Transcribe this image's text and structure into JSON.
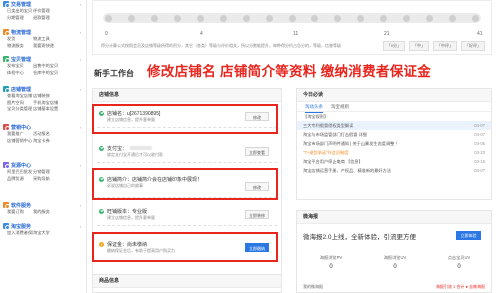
{
  "sidebar": {
    "groups": [
      {
        "title": "交易管理",
        "icon": "trade-icon",
        "color": "#3a8ee6",
        "rows": [
          [
            "已卖出的宝贝",
            "评价管理"
          ],
          [
            "分期管理",
            "退款管理"
          ]
        ]
      },
      {
        "title": "物流管理",
        "icon": "truck-icon",
        "color": "#f08a24",
        "rows": [
          [
            "发货",
            "物流工具"
          ],
          [
            "物流服务",
            "我要寄快递"
          ]
        ]
      },
      {
        "title": "宝贝管理",
        "icon": "goods-icon",
        "color": "#3cb371",
        "rows": [
          [
            "发布宝贝",
            "出售中的宝贝"
          ],
          [
            "体检中心",
            "仓库中的宝贝"
          ]
        ]
      },
      {
        "title": "店铺管理",
        "icon": "shop-icon",
        "color": "#21a0b5",
        "rows": [
          [
            "查看淘宝店铺",
            "店铺装修"
          ],
          [
            "图片空间",
            "手机淘宝店铺"
          ],
          [
            "宝贝分类管理",
            "店铺基本设置"
          ]
        ]
      },
      {
        "title": "营销中心",
        "icon": "marketing-icon",
        "color": "#e04b4b",
        "rows": [
          [
            "我要推广",
            "活动报名"
          ],
          [
            "店铺营销中心",
            "淘宝卡券"
          ]
        ]
      },
      {
        "title": "货源中心",
        "icon": "supply-icon",
        "color": "#7b68ee",
        "rows": [
          [
            "阿里巴巴批发",
            "分销管理"
          ],
          [
            "品牌货源",
            "采购导航"
          ]
        ]
      },
      {
        "title": "软件服务",
        "icon": "software-icon",
        "color": "#f08a24",
        "rows": [
          [
            "我要订购",
            "我的服务"
          ]
        ]
      },
      {
        "title": "淘宝服务",
        "icon": "service-icon",
        "color": "#3a8ee6",
        "rows": [
          [
            "加入消费者保障",
            "淘宝大学"
          ]
        ]
      }
    ]
  },
  "top_chart": {
    "scale_labels": [
      "0",
      "4",
      "11",
      "21",
      "41"
    ],
    "note": "得分计算公式按照会员及店铺等级所得的积分，其它（各类）等级与评价相关，所以分数能提升，每种得分约占总分的，等级，信誉等级",
    "buttons": [
      "「0分」",
      "「中」",
      "「中评」",
      "「好评」"
    ]
  },
  "headline": "修改店铺名 店铺简介等资料  缴纳消费者保证金",
  "section_title": "新手工作台",
  "store_card": {
    "title": "店铺信息",
    "tasks": [
      {
        "main": "店铺名：u[2671390895]",
        "sub": "建立店铺信息，提升客单量",
        "btn": "修改",
        "status": "done"
      },
      {
        "main": "支付宝：",
        "sub": "绑定支付宝开通后才可以收付款",
        "btn": "立即查看",
        "status": "done"
      },
      {
        "main": "店铺简介：店铺简介会在店铺印象中展现！",
        "sub": "诉说店铺自己的故事",
        "btn": "修改",
        "status": "done"
      },
      {
        "main": "旺铺版本：专业版",
        "sub": "建立店铺信息，提升客单量",
        "btn": "立即装修",
        "status": "done"
      },
      {
        "main": "保证金：尚未缴纳",
        "sub": "缴纳保证金后，有助于提高用户购买力",
        "btn": "立即缴纳",
        "status": "warn"
      }
    ]
  },
  "goods_card": {
    "title": "商品信息"
  },
  "today": {
    "title": "今日必读",
    "tabs": [
      "淘动头条",
      "淘宝规则"
    ],
    "news": [
      {
        "text": "【淘宝规则】",
        "date": "",
        "style": "plain"
      },
      {
        "text": "三大专利假冒侵权类型解读",
        "date": "04-07",
        "style": "highlight"
      },
      {
        "text": "淘宝与市场监管部门打击假冒 详细",
        "date": "04-07",
        "style": "plain"
      },
      {
        "text": "淘宝市场部门声明件通知 | 关于山寨发生态度调整 ！",
        "date": "04-05",
        "style": "plain"
      },
      {
        "text": "\"7+退货承诺\"外会员制度",
        "date": "03-23",
        "style": "hot"
      },
      {
        "text": "淘宝平台用户停止电商 【信息】",
        "date": "03-15",
        "style": "plain"
      },
      {
        "text": "淘宝店铺运营手册，产权品、精准新的最好方法",
        "date": "04-07",
        "style": "plain"
      }
    ]
  },
  "sea": {
    "title": "微海报",
    "promo": "微海报2.0上线，全新体验，引流更方便",
    "btn": "立即体验",
    "stats": [
      {
        "label": "海报浏览PV",
        "value": "0"
      },
      {
        "label": "海报浏览UV",
        "value": "0"
      },
      {
        "label": "点击宝贝UV",
        "value": "0"
      }
    ],
    "foot_left": "我的微海报",
    "foot_right": "海报引流 1 合计 ● 去做海报"
  }
}
